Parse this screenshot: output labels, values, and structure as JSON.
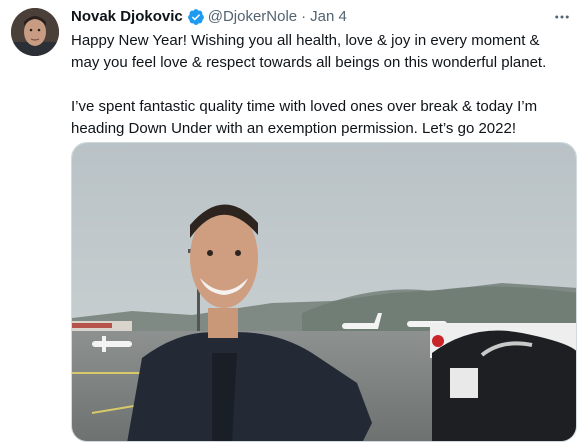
{
  "tweet": {
    "author_name": "Novak Djokovic",
    "handle": "@DjokerNole",
    "separator": "·",
    "date": "Jan 4",
    "paragraphs": [
      "Happy New Year! Wishing you all health, love & joy in every moment & may you feel love & respect towards all beings on this wonderful planet.",
      "I’ve spent fantastic quality time with loved ones over break & today I’m heading Down Under with an exemption permission. Let’s go 2022!"
    ],
    "verified_badge_icon": "verified-check-icon",
    "more_icon": "more-horizontal-icon"
  },
  "colors": {
    "verified_blue": "#1d9bf0",
    "secondary_text": "#536471",
    "border": "#cfd9de"
  }
}
